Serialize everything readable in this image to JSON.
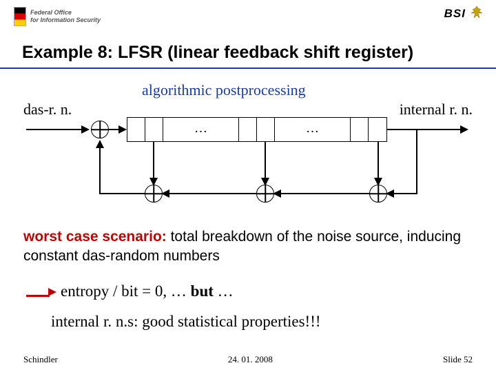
{
  "header": {
    "office_line1": "Federal Office",
    "office_line2": "for Information Security",
    "bsi": "BSI"
  },
  "title": "Example 8: LFSR (linear feedback shift register)",
  "labels": {
    "das": "das-r. n.",
    "algo": "algorithmic postprocessing",
    "internal": "internal r. n."
  },
  "diagram": {
    "dots1": "…",
    "dots2": "…"
  },
  "body": {
    "worst_lead": "worst case scenario:",
    "worst_rest": " total breakdown of the noise source, inducing constant das-random numbers",
    "entropy_pre": "entropy / bit = 0, … ",
    "entropy_bold": "but",
    "entropy_post": " …",
    "internal_good": "internal r. n.s: good statistical properties!!!"
  },
  "footer": {
    "author": "Schindler",
    "date": "24. 01. 2008",
    "slide": "Slide 52"
  }
}
